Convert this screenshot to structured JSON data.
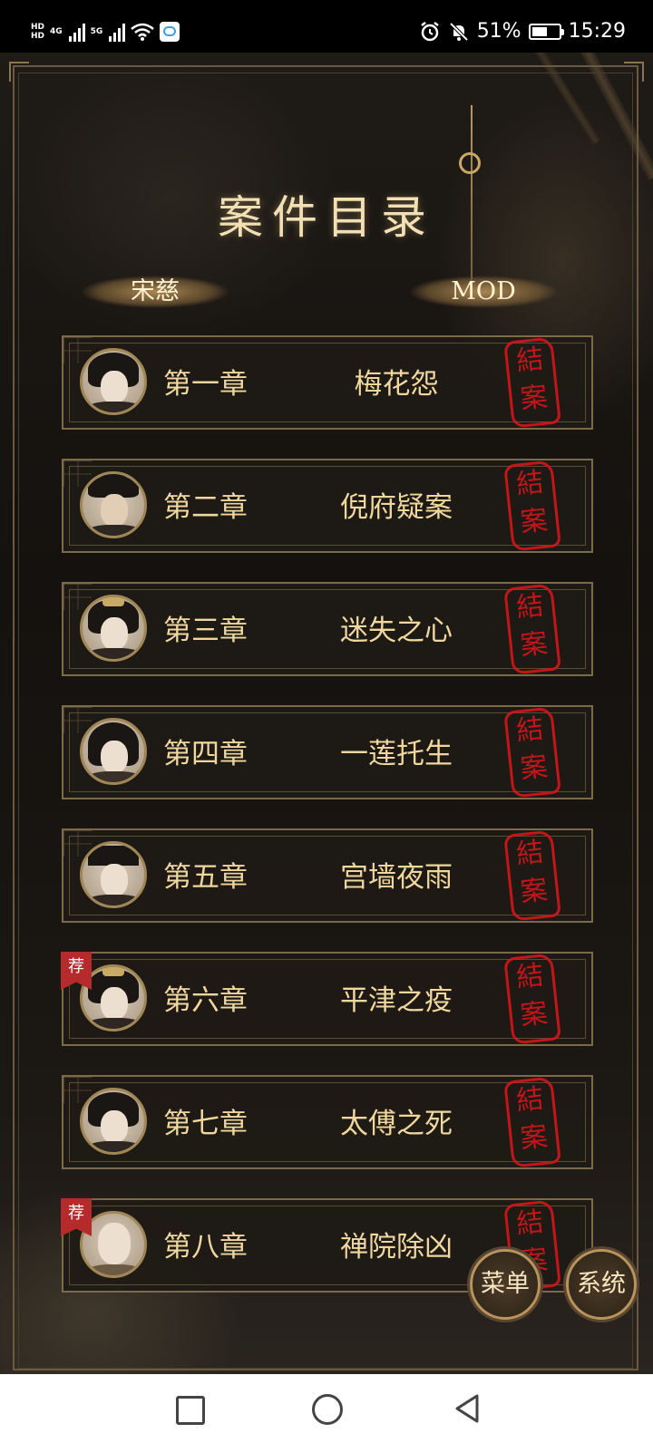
{
  "status_bar": {
    "network_left_1": "4G",
    "network_left_2": "5G",
    "hd1": "HD",
    "hd2": "HD",
    "battery_percent": "51%",
    "time": "15:29"
  },
  "game": {
    "title": "案件目录",
    "tabs": [
      {
        "label": "宋慈"
      },
      {
        "label": "MOD"
      }
    ],
    "chapters": [
      {
        "chapter": "第一章",
        "title": "梅花怨",
        "stamp": "結案",
        "recommended": false
      },
      {
        "chapter": "第二章",
        "title": "倪府疑案",
        "stamp": "結案",
        "recommended": false
      },
      {
        "chapter": "第三章",
        "title": "迷失之心",
        "stamp": "結案",
        "recommended": false
      },
      {
        "chapter": "第四章",
        "title": "一莲托生",
        "stamp": "結案",
        "recommended": false
      },
      {
        "chapter": "第五章",
        "title": "宫墙夜雨",
        "stamp": "結案",
        "recommended": false
      },
      {
        "chapter": "第六章",
        "title": "平津之疫",
        "stamp": "結案",
        "recommended": true,
        "badge": "荐"
      },
      {
        "chapter": "第七章",
        "title": "太傅之死",
        "stamp": "結案",
        "recommended": false
      },
      {
        "chapter": "第八章",
        "title": "禅院除凶",
        "stamp": "結案",
        "recommended": true,
        "badge": "荐"
      }
    ],
    "menu_button": "菜单",
    "system_button": "系统"
  },
  "colors": {
    "accent_gold": "#f0d79e",
    "stamp_red": "#d4161b",
    "badge_red": "#b52a2a"
  }
}
